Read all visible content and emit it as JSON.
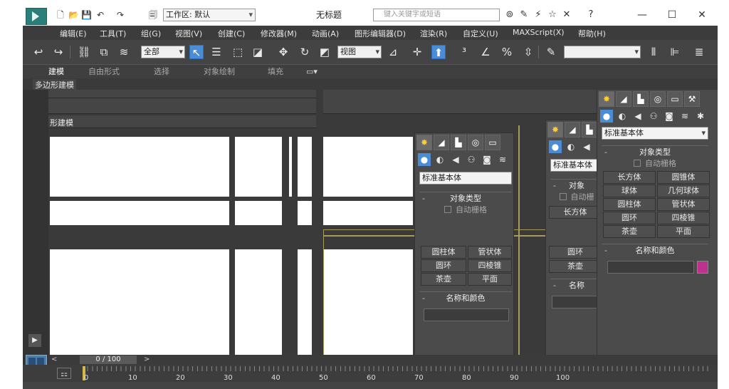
{
  "titlebar": {
    "workspace_label": "工作区: 默认",
    "window_title": "无标题",
    "search_placeholder": "键入关键字或短语"
  },
  "menus": [
    "编辑(E)",
    "工具(T)",
    "组(G)",
    "视图(V)",
    "创建(C)",
    "修改器(M)",
    "动画(A)",
    "图形编辑器(D)",
    "渲染(R)",
    "自定义(U)",
    "MAXScript(X)",
    "帮助(H)"
  ],
  "toolbar": {
    "filter_select": "全部",
    "view_select": "视图"
  },
  "ribbon": {
    "tabs": [
      "建模",
      "自由形式",
      "选择",
      "对象绘制",
      "填充"
    ],
    "panel_label": "多边形建模"
  },
  "viewport": {
    "left_label": "形建模"
  },
  "command_panel": {
    "category": "标准基本体",
    "rollout_object_type": "对象类型",
    "auto_grid": "自动栅格",
    "buttons": [
      "长方体",
      "圆锥体",
      "球体",
      "几何球体",
      "圆柱体",
      "管状体",
      "圆环",
      "四棱锥",
      "茶壶",
      "平面"
    ],
    "rollout_name_color": "名称和颜色"
  },
  "panel_mid": {
    "category": "标准基本体",
    "rollout_object_type": "对象类型",
    "auto_grid": "自动栅格",
    "row1": [
      "圆柱体",
      "管状体"
    ],
    "row2": [
      "圆环",
      "四棱锥"
    ],
    "row3": [
      "茶壶",
      "平面"
    ],
    "rollout_name_color": "名称和颜色"
  },
  "panel_small": {
    "category": "标准基本体",
    "rollout_object_type": "对象",
    "auto_grid": "自动栅",
    "btn1": "长方体",
    "btn2": "圆环",
    "btn3": "茶壶",
    "rollout_name_color": "名称"
  },
  "timeline": {
    "frame_readout": "0 / 100",
    "ticks": [
      "0",
      "10",
      "20",
      "30",
      "40",
      "50",
      "60",
      "70",
      "80",
      "90",
      "100"
    ]
  }
}
